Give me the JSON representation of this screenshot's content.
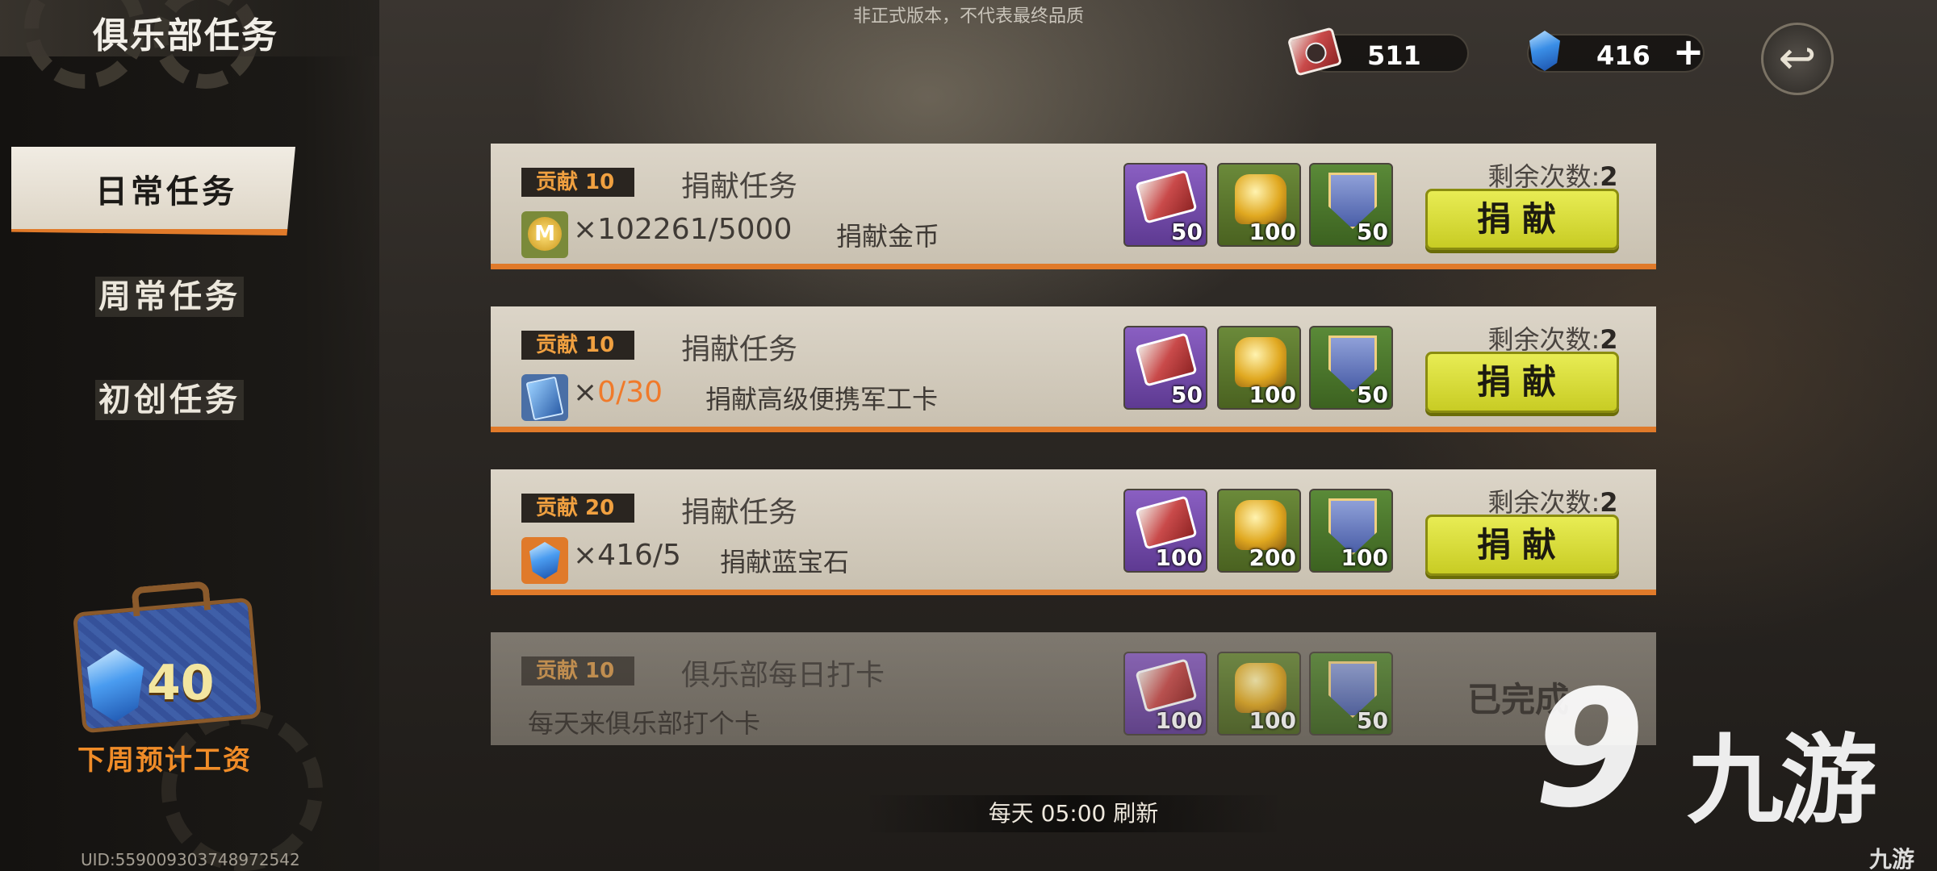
{
  "notice": "非正式版本，不代表最终品质",
  "header": {
    "title": "俱乐部任务",
    "tickets": "511",
    "gems": "416",
    "plus": "+",
    "back_symbol": "↩"
  },
  "tabs": [
    {
      "label": "日常任务",
      "active": true
    },
    {
      "label": "周常任务",
      "active": false
    },
    {
      "label": "初创任务",
      "active": false
    }
  ],
  "salary": {
    "amount": "40",
    "label": "下周预计工资"
  },
  "uid": "UID:559009303748972542",
  "remain_label": "剩余次数:",
  "donate_label": "捐献",
  "tasks": [
    {
      "badge": "贡献 10",
      "name": "捐献任务",
      "req_icon": "gold-coin-icon",
      "req_x": "×",
      "req_value": "102261/5000",
      "req_desc": "捐献金币",
      "rewards": [
        "50",
        "100",
        "50"
      ],
      "remain": "2"
    },
    {
      "badge": "贡献 10",
      "name": "捐献任务",
      "req_icon": "military-card-icon",
      "req_x": "×",
      "req_value": "0/30",
      "req_desc": "捐献高级便携军工卡",
      "rewards": [
        "50",
        "100",
        "50"
      ],
      "remain": "2"
    },
    {
      "badge": "贡献 20",
      "name": "捐献任务",
      "req_icon": "sapphire-icon",
      "req_x": "×",
      "req_value": "416/5",
      "req_desc": "捐献蓝宝石",
      "rewards": [
        "100",
        "200",
        "100"
      ],
      "remain": "2"
    },
    {
      "badge": "贡献 10",
      "name": "俱乐部每日打卡",
      "desc": "每天来俱乐部打个卡",
      "rewards": [
        "100",
        "100",
        "50"
      ],
      "status": "已完成"
    }
  ],
  "refresh_text": "每天 05:00 刷新",
  "watermark": {
    "logo": "9",
    "text": "九游",
    "small": "九游"
  }
}
